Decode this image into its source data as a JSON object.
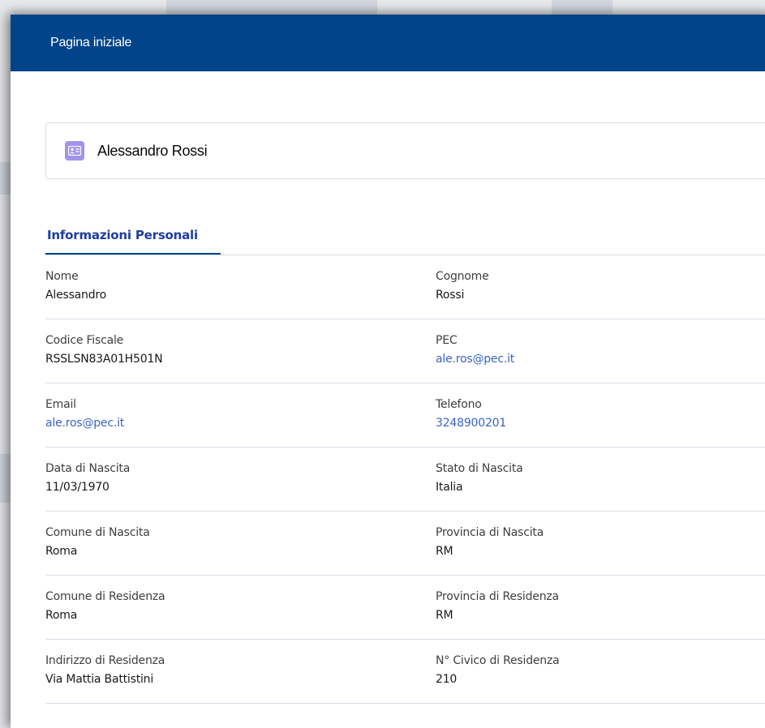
{
  "header": {
    "title": "Pagina iniziale"
  },
  "record": {
    "icon": "contact-card-icon",
    "name": "Alessandro Rossi"
  },
  "tabs": [
    {
      "label": "Informazioni Personali",
      "active": true
    }
  ],
  "colors": {
    "header_bg": "#014489",
    "tab_active": "#1e3da0",
    "link": "#3b62c7",
    "record_icon_bg": "#a094ed"
  },
  "fields": [
    {
      "left": {
        "label": "Nome",
        "value": "Alessandro"
      },
      "right": {
        "label": "Cognome",
        "value": "Rossi"
      }
    },
    {
      "left": {
        "label": "Codice Fiscale",
        "value": "RSSLSN83A01H501N"
      },
      "right": {
        "label": "PEC",
        "value": "ale.ros@pec.it"
      }
    },
    {
      "left": {
        "label": "Email",
        "value": "ale.ros@pec.it"
      },
      "right": {
        "label": "Telefono",
        "value": "3248900201"
      }
    },
    {
      "left": {
        "label": "Data di Nascita",
        "value": "11/03/1970"
      },
      "right": {
        "label": "Stato di Nascita",
        "value": "Italia"
      }
    },
    {
      "left": {
        "label": "Comune di Nascita",
        "value": "Roma"
      },
      "right": {
        "label": "Provincia di Nascita",
        "value": "RM"
      }
    },
    {
      "left": {
        "label": "Comune di Residenza",
        "value": "Roma"
      },
      "right": {
        "label": "Provincia di Residenza",
        "value": "RM"
      }
    },
    {
      "left": {
        "label": "Indirizzo di Residenza",
        "value": "Via Mattia Battistini"
      },
      "right": {
        "label": "N° Civico di Residenza",
        "value": "210"
      }
    }
  ]
}
